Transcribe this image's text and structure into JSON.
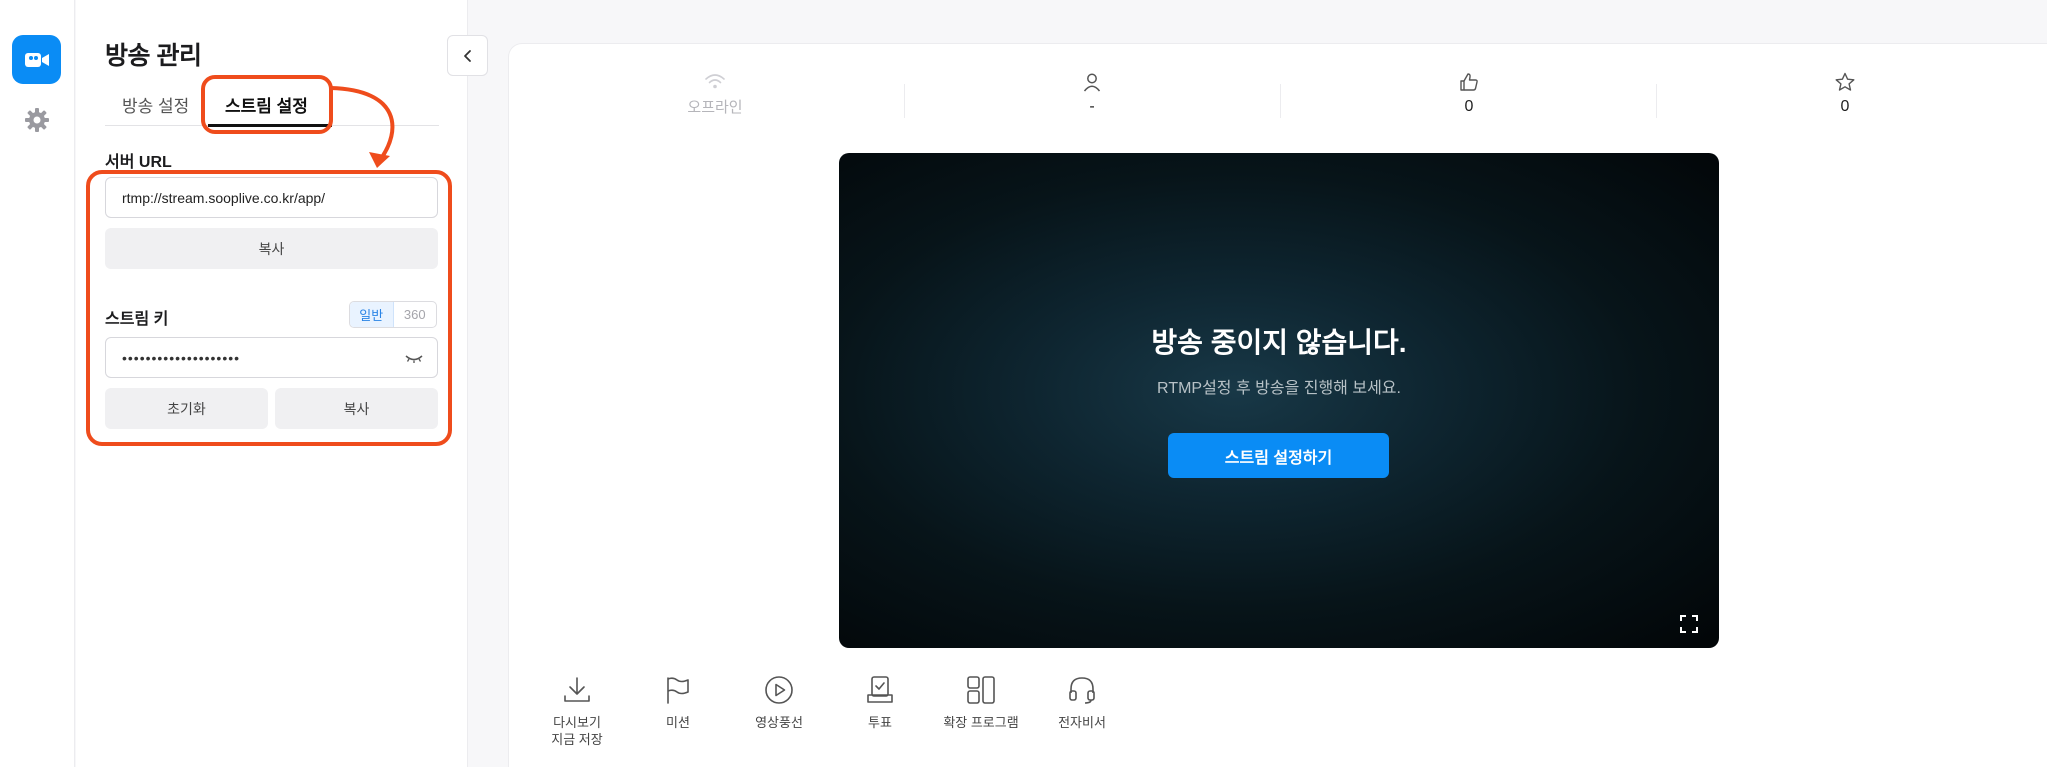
{
  "rail": {
    "items": [
      {
        "icon": "video-camera-icon",
        "active": true
      },
      {
        "icon": "gear-icon",
        "active": false
      }
    ]
  },
  "panel": {
    "title": "방송 관리",
    "tabs": [
      {
        "label": "방송 설정",
        "active": false
      },
      {
        "label": "스트림 설정",
        "active": true
      }
    ],
    "server_url": {
      "label": "서버 URL",
      "value": "rtmp://stream.sooplive.co.kr/app/",
      "copy_label": "복사"
    },
    "stream_key": {
      "label": "스트림 키",
      "modes": [
        "일반",
        "360"
      ],
      "active_mode": "일반",
      "masked_value": "••••••••••••••••••••",
      "reset_label": "초기화",
      "copy_label": "복사"
    },
    "annotation_color": "#ef4c1c"
  },
  "stats": [
    {
      "icon": "wifi-icon",
      "value": "오프라인"
    },
    {
      "icon": "person-icon",
      "value": "-"
    },
    {
      "icon": "thumbs-up-icon",
      "value": "0"
    },
    {
      "icon": "star-icon",
      "value": "0"
    }
  ],
  "player": {
    "title": "방송 중이지 않습니다.",
    "subtitle": "RTMP설정 후 방송을 진행해 보세요.",
    "button_label": "스트림 설정하기",
    "accent": "#0a8cf5"
  },
  "tools": [
    {
      "icon": "download-icon",
      "label_line1": "다시보기",
      "label_line2": "지금 저장"
    },
    {
      "icon": "flag-icon",
      "label_line1": "미션",
      "label_line2": ""
    },
    {
      "icon": "play-circle-icon",
      "label_line1": "영상풍선",
      "label_line2": ""
    },
    {
      "icon": "vote-icon",
      "label_line1": "투표",
      "label_line2": ""
    },
    {
      "icon": "extension-icon",
      "label_line1": "확장 프로그램",
      "label_line2": ""
    },
    {
      "icon": "headset-icon",
      "label_line1": "전자비서",
      "label_line2": ""
    }
  ]
}
